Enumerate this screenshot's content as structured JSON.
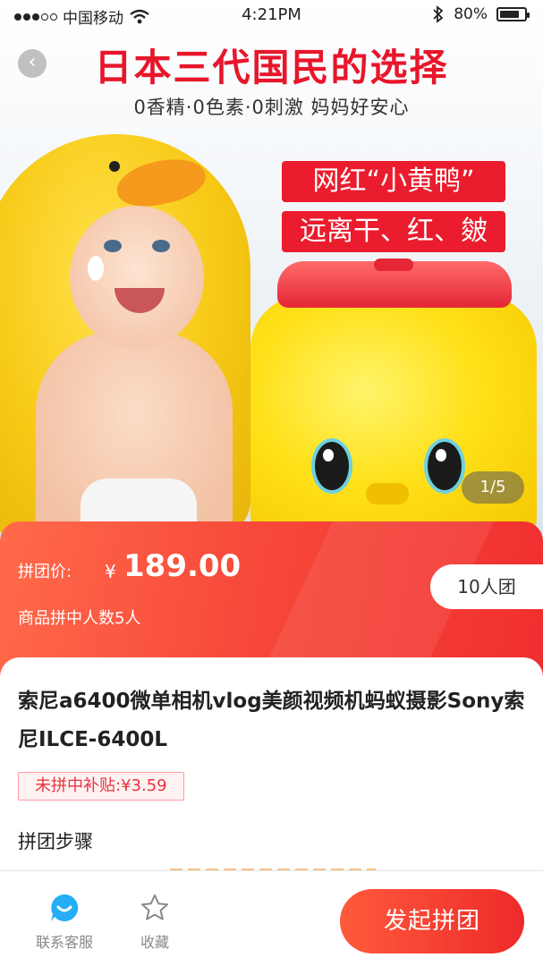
{
  "status_bar": {
    "carrier": "中国移动",
    "time": "4:21PM",
    "battery": "80%",
    "battery_level": 0.8,
    "icons": [
      "signal-icon",
      "wifi-icon",
      "bluetooth-icon",
      "battery-icon"
    ]
  },
  "hero": {
    "title": "日本三代国民的选择",
    "subtitle": "0香精·0色素·0刺激  妈妈好安心",
    "tag_1": "网红“小黄鸭”",
    "tag_2": "远离干、红、皴",
    "page_indicator": "1/5",
    "back_icon": "chevron-left-icon"
  },
  "price": {
    "label": "拼团价:",
    "currency": "¥",
    "value": "189.00",
    "group_count_text": "商品拼中人数5人",
    "group_badge": "10人团"
  },
  "product": {
    "title": "索尼a6400微单相机vlog美颜视频机蚂蚁摄影Sony索尼ILCE-6400L",
    "subsidy": "未拼中补贴:¥3.59",
    "steps_title": "拼团步骤"
  },
  "bottom_bar": {
    "service_label": "联系客服",
    "favorite_label": "收藏",
    "start_button": "发起拼团"
  },
  "colors": {
    "accent_red": "#ea1c2d",
    "banner_gradient_start": "#ff6a4a",
    "banner_gradient_end": "#f02f2f",
    "service_icon": "#25aef5"
  }
}
